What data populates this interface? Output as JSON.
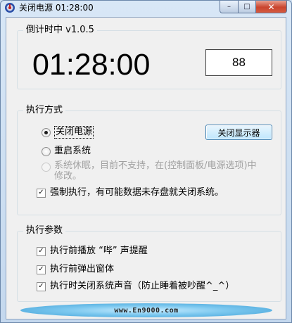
{
  "window": {
    "title": "关闭电源 01:28:00",
    "caption": {
      "minimize": "–",
      "maximize": "□",
      "close": "✕"
    }
  },
  "timer_group": {
    "title": "倒计时中 v1.0.5",
    "time": "01:28:00",
    "counter": "88"
  },
  "mode_group": {
    "title": "执行方式",
    "options": [
      {
        "label": "关闭电源",
        "checked": true,
        "enabled": true
      },
      {
        "label": "重启系统",
        "checked": false,
        "enabled": true
      },
      {
        "label": "系统休眠，目前不支持，在(控制面板/电源选项)中修改。",
        "checked": false,
        "enabled": false
      }
    ],
    "force_label": "强制执行，有可能数据未存盘就关闭系统。",
    "force_checked": true,
    "monitor_button": "关闭显示器"
  },
  "params_group": {
    "title": "执行参数",
    "items": [
      {
        "label": "执行前播放 “哔” 声提醒",
        "checked": true
      },
      {
        "label": "执行前弹出窗体",
        "checked": true
      },
      {
        "label": "执行时关闭系统声音（防止睡着被吵醒^_^）",
        "checked": true
      }
    ]
  },
  "banner": {
    "text": "www.En9000.com"
  }
}
